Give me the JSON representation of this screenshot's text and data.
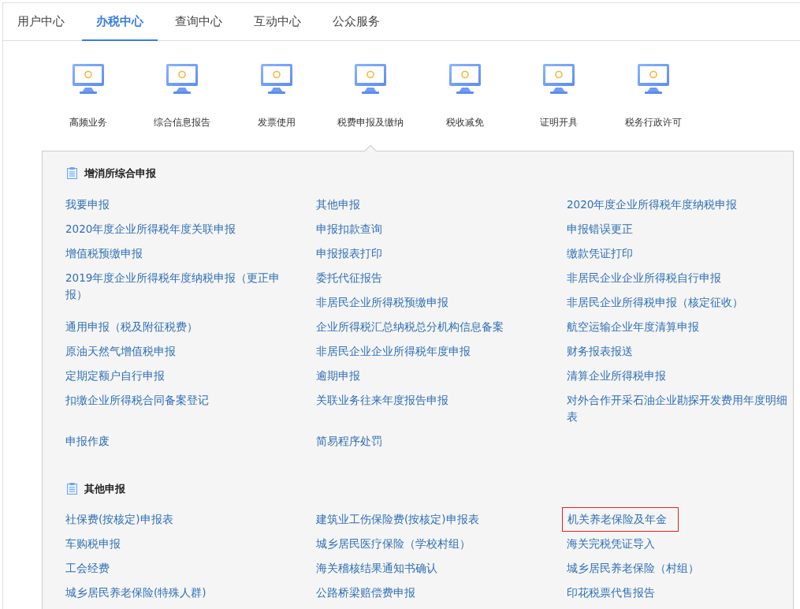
{
  "tabs": [
    {
      "label": "用户中心",
      "selected": false
    },
    {
      "label": "办税中心",
      "selected": true
    },
    {
      "label": "查询中心",
      "selected": false
    },
    {
      "label": "互动中心",
      "selected": false
    },
    {
      "label": "公众服务",
      "selected": false
    }
  ],
  "categories": [
    {
      "label": "高频业务",
      "selected": false
    },
    {
      "label": "综合信息报告",
      "selected": false
    },
    {
      "label": "发票使用",
      "selected": false
    },
    {
      "label": "税费申报及缴纳",
      "selected": true
    },
    {
      "label": "税收减免",
      "selected": false
    },
    {
      "label": "证明开具",
      "selected": false
    },
    {
      "label": "税务行政许可",
      "selected": false
    }
  ],
  "sections": [
    {
      "title": "增消所综合申报",
      "items": [
        {
          "label": "我要申报",
          "highlighted": false
        },
        {
          "label": "其他申报",
          "highlighted": false
        },
        {
          "label": "2020年度企业所得税年度纳税申报",
          "highlighted": false
        },
        {
          "label": "2020年度企业所得税年度关联申报",
          "highlighted": false
        },
        {
          "label": "申报扣款查询",
          "highlighted": false
        },
        {
          "label": "申报错误更正",
          "highlighted": false
        },
        {
          "label": "增值税预缴申报",
          "highlighted": false
        },
        {
          "label": "申报报表打印",
          "highlighted": false
        },
        {
          "label": "缴款凭证打印",
          "highlighted": false
        },
        {
          "label": "2019年度企业所得税年度纳税申报（更正申报）",
          "highlighted": false
        },
        {
          "label": "委托代征报告",
          "highlighted": false
        },
        {
          "label": "非居民企业企业所得税自行申报",
          "highlighted": false
        },
        {
          "label": "非居民企业所得税预缴申报",
          "highlighted": false
        },
        {
          "label": "非居民企业所得税申报（核定征收）",
          "highlighted": false
        },
        {
          "label": "通用申报（税及附征税费）",
          "highlighted": false
        },
        {
          "label": "企业所得税汇总纳税总分机构信息备案",
          "highlighted": false
        },
        {
          "label": "航空运输企业年度清算申报",
          "highlighted": false
        },
        {
          "label": "原油天然气增值税申报",
          "highlighted": false
        },
        {
          "label": "非居民企业企业所得税年度申报",
          "highlighted": false
        },
        {
          "label": "财务报表报送",
          "highlighted": false
        },
        {
          "label": "定期定额户自行申报",
          "highlighted": false
        },
        {
          "label": "逾期申报",
          "highlighted": false
        },
        {
          "label": "清算企业所得税申报",
          "highlighted": false
        },
        {
          "label": "扣缴企业所得税合同备案登记",
          "highlighted": false
        },
        {
          "label": "关联业务往来年度报告申报",
          "highlighted": false
        },
        {
          "label": "对外合作开采石油企业勘探开发费用年度明细表",
          "highlighted": false
        },
        {
          "label": "申报作废",
          "highlighted": false
        },
        {
          "label": "简易程序处罚",
          "highlighted": false
        }
      ]
    },
    {
      "title": "其他申报",
      "items": [
        {
          "label": "社保费(按核定)申报表",
          "highlighted": false
        },
        {
          "label": "建筑业工伤保险费(按核定)申报表",
          "highlighted": false
        },
        {
          "label": "机关养老保险及年金",
          "highlighted": true
        },
        {
          "label": "车购税申报",
          "highlighted": false
        },
        {
          "label": "城乡居民医疗保险（学校村组）",
          "highlighted": false
        },
        {
          "label": "海关完税凭证导入",
          "highlighted": false
        },
        {
          "label": "工会经费",
          "highlighted": false
        },
        {
          "label": "海关稽核结果通知书确认",
          "highlighted": false
        },
        {
          "label": "城乡居民养老保险（村组）",
          "highlighted": false
        },
        {
          "label": "城乡居民养老保险(特殊人群)",
          "highlighted": false
        },
        {
          "label": "公路桥梁赔偿费申报",
          "highlighted": false
        },
        {
          "label": "印花税票代售报告",
          "highlighted": false
        }
      ]
    }
  ]
}
